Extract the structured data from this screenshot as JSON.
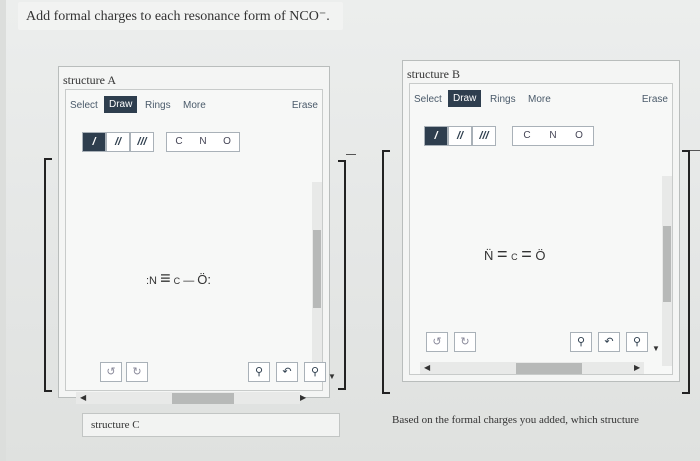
{
  "question": {
    "text": "Add formal charges to each resonance form of NCO⁻."
  },
  "editor": {
    "tabs": {
      "select": "Select",
      "draw": "Draw",
      "rings": "Rings",
      "more": "More"
    },
    "erase": "Erase",
    "bond_buttons": [
      "/",
      "//",
      "///"
    ],
    "atoms": [
      "C",
      "N",
      "O"
    ]
  },
  "structure_a": {
    "title": "structure A",
    "molecule": {
      "n": ":N",
      "bond1": "≡",
      "c": "C",
      "bond2": "—",
      "o": "Ö:"
    }
  },
  "structure_b": {
    "title": "structure B",
    "molecule": {
      "n": "N̈",
      "bond1": "=",
      "c": "C",
      "bond2": "=",
      "o": "Ö"
    }
  },
  "structure_c": {
    "title": "structure C"
  },
  "footer": {
    "text": "Based on the formal charges you added, which structure"
  },
  "colors": {
    "active_tab": "#2e3e4e",
    "panel_bg": "#f4f5f4"
  },
  "icons": [
    "undo-icon",
    "redo-icon",
    "zoom-in-icon",
    "reset-zoom-icon",
    "zoom-out-icon"
  ]
}
